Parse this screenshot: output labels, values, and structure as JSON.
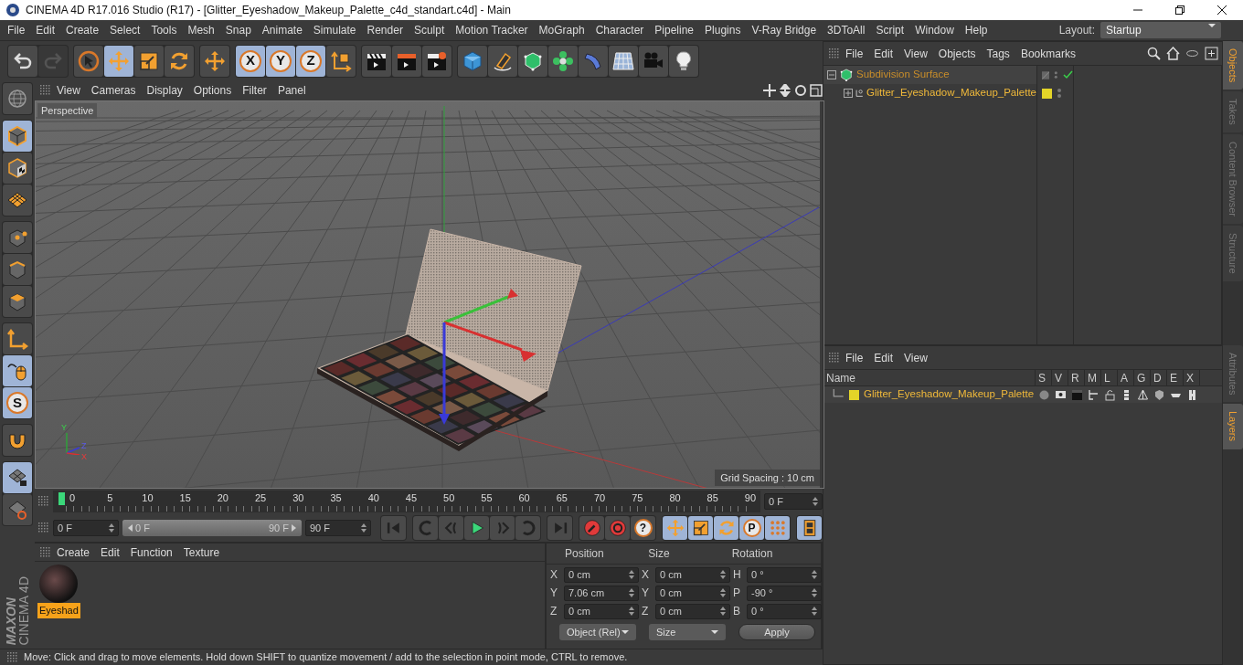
{
  "window": {
    "title": "CINEMA 4D R17.016 Studio (R17) - [Glitter_Eyeshadow_Makeup_Palette_c4d_standart.c4d] - Main"
  },
  "menu": [
    "File",
    "Edit",
    "Create",
    "Select",
    "Tools",
    "Mesh",
    "Snap",
    "Animate",
    "Simulate",
    "Render",
    "Sculpt",
    "Motion Tracker",
    "MoGraph",
    "Character",
    "Pipeline",
    "Plugins",
    "V-Ray Bridge",
    "3DToAll",
    "Script",
    "Window",
    "Help"
  ],
  "layout": {
    "label": "Layout:",
    "value": "Startup"
  },
  "toolbar": [
    [
      {
        "kind": "undo",
        "selected": false,
        "disabled": false
      },
      {
        "kind": "redo",
        "selected": false,
        "disabled": true
      }
    ],
    [
      {
        "kind": "select",
        "selected": false,
        "disabled": false
      },
      {
        "kind": "move",
        "selected": true,
        "disabled": false
      },
      {
        "kind": "scale",
        "selected": false,
        "disabled": false
      },
      {
        "kind": "rotate",
        "selected": false,
        "disabled": false
      }
    ],
    [
      {
        "kind": "move",
        "selected": false,
        "disabled": false
      }
    ],
    [
      {
        "kind": "axis-lock",
        "text": "X",
        "selected": true,
        "disabled": false
      },
      {
        "kind": "axis-lock",
        "text": "Y",
        "selected": true,
        "disabled": false
      },
      {
        "kind": "axis-lock",
        "text": "Z",
        "selected": true,
        "disabled": false
      },
      {
        "kind": "coord",
        "selected": false,
        "disabled": false
      }
    ],
    [
      {
        "kind": "clap",
        "selected": false,
        "disabled": false
      },
      {
        "kind": "clap-render",
        "selected": false,
        "disabled": false
      },
      {
        "kind": "clap-gear",
        "selected": false,
        "disabled": false
      }
    ],
    [
      {
        "kind": "cube",
        "selected": false,
        "disabled": false
      },
      {
        "kind": "pen",
        "selected": false,
        "disabled": false
      },
      {
        "kind": "subdiv",
        "selected": false,
        "disabled": false
      },
      {
        "kind": "cloner",
        "selected": false,
        "disabled": false
      },
      {
        "kind": "deformer",
        "selected": false,
        "disabled": false
      },
      {
        "kind": "floor",
        "selected": false,
        "disabled": false
      },
      {
        "kind": "camera",
        "selected": false,
        "disabled": false
      },
      {
        "kind": "light",
        "selected": false,
        "disabled": false
      }
    ]
  ],
  "left_toolbar": [
    [
      {
        "kind": "globe",
        "selected": false
      }
    ],
    [
      {
        "kind": "model",
        "selected": true
      },
      {
        "kind": "texture",
        "selected": false
      },
      {
        "kind": "workplane",
        "selected": false
      }
    ],
    [
      {
        "kind": "points",
        "selected": false
      },
      {
        "kind": "edges",
        "selected": false
      },
      {
        "kind": "polygons",
        "selected": false
      }
    ],
    [
      {
        "kind": "axis",
        "selected": false
      },
      {
        "kind": "tweak",
        "selected": true
      },
      {
        "kind": "snap",
        "text": "S",
        "selected": true
      }
    ],
    [
      {
        "kind": "magnet",
        "selected": false
      }
    ],
    [
      {
        "kind": "wplock",
        "selected": true
      },
      {
        "kind": "wprot",
        "selected": false
      }
    ]
  ],
  "logo": {
    "brand": "MAXON",
    "product": "CINEMA 4D"
  },
  "viewport": {
    "menu": [
      "View",
      "Cameras",
      "Display",
      "Options",
      "Filter",
      "Panel"
    ],
    "camera": "Perspective",
    "grid_spacing": "Grid Spacing : 10 cm",
    "axis_labels": [
      "Y",
      "Z",
      "X"
    ]
  },
  "timeline": {
    "ticks": [
      "0",
      "5",
      "10",
      "15",
      "20",
      "25",
      "30",
      "35",
      "40",
      "45",
      "50",
      "55",
      "60",
      "65",
      "70",
      "75",
      "80",
      "85",
      "90"
    ],
    "current": "0 F"
  },
  "playback": {
    "start": "0 F",
    "range_start": "0 F",
    "range_end": "90 F",
    "range_bar": {
      "level": 1
    },
    "end": "90 F",
    "transport": [
      [
        {
          "kind": "go-start",
          "selected": false
        }
      ],
      [
        {
          "kind": "prev-key",
          "selected": false
        },
        {
          "kind": "prev-frame",
          "selected": false
        },
        {
          "kind": "play",
          "selected": false
        },
        {
          "kind": "next-frame",
          "selected": false
        },
        {
          "kind": "next-key",
          "selected": false
        }
      ],
      [
        {
          "kind": "go-end",
          "selected": false
        }
      ],
      [
        {
          "kind": "record",
          "selected": false
        },
        {
          "kind": "autokey",
          "selected": false
        },
        {
          "kind": "keysel",
          "text": "?",
          "selected": false
        }
      ],
      [
        {
          "kind": "move",
          "selected": true
        },
        {
          "kind": "scale",
          "selected": true
        },
        {
          "kind": "rotate",
          "selected": true
        },
        {
          "kind": "param",
          "text": "P",
          "selected": true
        },
        {
          "kind": "dots",
          "selected": true
        }
      ],
      [
        {
          "kind": "film",
          "selected": true
        }
      ]
    ]
  },
  "materials": {
    "menu": [
      "Create",
      "Edit",
      "Function",
      "Texture"
    ],
    "items": [
      {
        "name": "Eyeshad",
        "selected": true
      }
    ]
  },
  "coordinates": {
    "headers": [
      "Position",
      "Size",
      "Rotation"
    ],
    "rows": [
      {
        "pos_axis": "X",
        "pos": "0 cm",
        "size_axis": "X",
        "size": "0 cm",
        "rot_axis": "H",
        "rot": "0 °"
      },
      {
        "pos_axis": "Y",
        "pos": "7.06 cm",
        "size_axis": "Y",
        "size": "0 cm",
        "rot_axis": "P",
        "rot": "-90 °"
      },
      {
        "pos_axis": "Z",
        "pos": "0 cm",
        "size_axis": "Z",
        "size": "0 cm",
        "rot_axis": "B",
        "rot": "0 °"
      }
    ],
    "mode": "Object (Rel)",
    "size_mode": "Size",
    "apply": "Apply"
  },
  "status_bar": "Move: Click and drag to move elements. Hold down SHIFT to quantize movement / add to the selection in point mode, CTRL to remove.",
  "objects": {
    "menu": [
      "File",
      "Edit",
      "View",
      "Objects",
      "Tags",
      "Bookmarks"
    ],
    "tree": [
      {
        "name": "Subdivision Surface",
        "kind": "subdiv",
        "expanded": true,
        "enabled": true,
        "children": [
          {
            "name": "Glitter_Eyeshadow_Makeup_Palette",
            "kind": "null",
            "expanded": false,
            "color": "#e3d428"
          }
        ]
      }
    ]
  },
  "objects_tabs": [
    {
      "label": "Objects",
      "selected": true
    },
    {
      "label": "Takes",
      "selected": false
    },
    {
      "label": "Content Browser",
      "selected": false
    },
    {
      "label": "Structure",
      "selected": false
    }
  ],
  "layers": {
    "menu": [
      "File",
      "Edit",
      "View"
    ],
    "columns": [
      "Name",
      "S",
      "V",
      "R",
      "M",
      "L",
      "A",
      "G",
      "D",
      "E",
      "X"
    ],
    "rows": [
      {
        "name": "Glitter_Eyeshadow_Makeup_Palette",
        "color": "#e3d428"
      }
    ]
  },
  "layers_tabs": [
    {
      "label": "Attributes",
      "selected": false
    },
    {
      "label": "Layers",
      "selected": true
    }
  ]
}
